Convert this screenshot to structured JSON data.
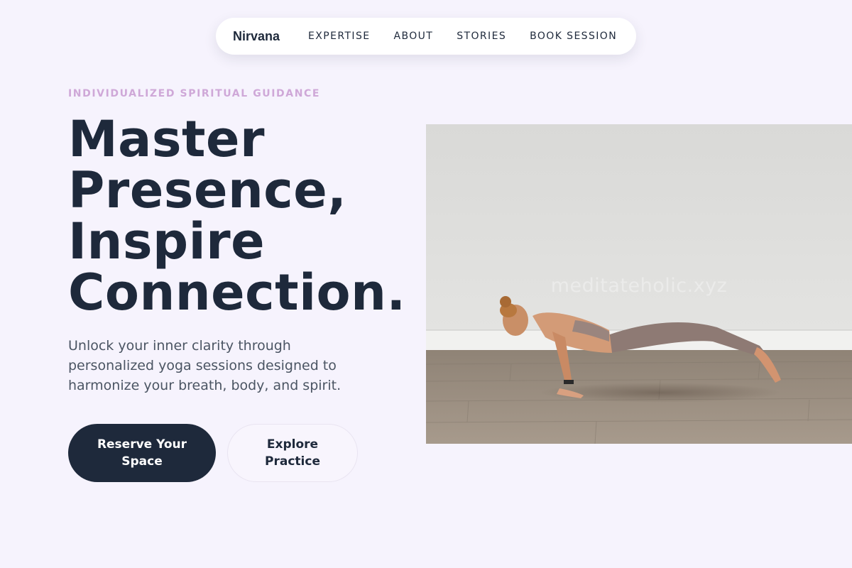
{
  "nav": {
    "brand": "Nirvana",
    "items": [
      {
        "label": "EXPERTISE"
      },
      {
        "label": "ABOUT"
      },
      {
        "label": "STORIES"
      },
      {
        "label": "BOOK SESSION"
      }
    ]
  },
  "hero": {
    "eyebrow": "INDIVIDUALIZED SPIRITUAL GUIDANCE",
    "headline_lines": [
      "Master",
      "Presence,",
      "Inspire",
      "Connection."
    ],
    "description": "Unlock your inner clarity through personalized yoga sessions designed to harmonize your breath, body, and spirit.",
    "primary_cta": "Reserve Your Space",
    "secondary_cta": "Explore Practice",
    "image_watermark": "meditateholic.xyz"
  },
  "colors": {
    "background": "#f6f3fd",
    "ink": "#1e293b",
    "eyebrow": "#cfa8d8",
    "body_text": "#4b5563"
  },
  "icons": {
    "hero_image": "woman-in-plank-pose-photo"
  }
}
